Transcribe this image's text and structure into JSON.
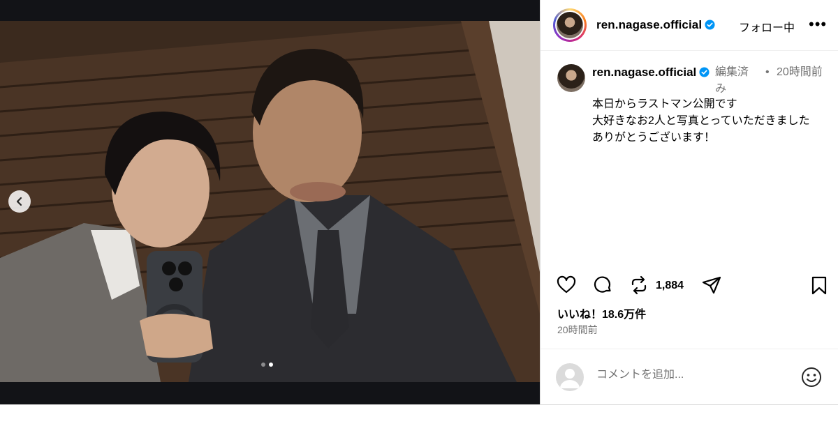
{
  "header": {
    "username": "ren.nagase.official",
    "follow_status": "フォロー中",
    "more": "•••"
  },
  "caption": {
    "username": "ren.nagase.official",
    "edited": "編集済み",
    "separator": "•",
    "time": "20時間前",
    "lines": [
      "本日からラストマン公開です",
      "大好きなお2人と写真とっていただきました",
      "ありがとうございます！"
    ]
  },
  "carousel": {
    "slide_count": 2,
    "active_slide": 2
  },
  "actions": {
    "repost_count": "1,884"
  },
  "likes_text": "いいね！18.6万件",
  "post_time": "20時間前",
  "comment": {
    "placeholder": "コメントを追加..."
  },
  "colors": {
    "verified": "#0095f6",
    "muted_text": "#737373",
    "border": "#dbdbdb"
  },
  "icons": [
    "chevron-left-icon",
    "verified-badge-icon",
    "more-icon",
    "heart-icon",
    "comment-icon",
    "repost-icon",
    "share-icon",
    "bookmark-icon",
    "user-placeholder-icon",
    "emoji-icon"
  ]
}
